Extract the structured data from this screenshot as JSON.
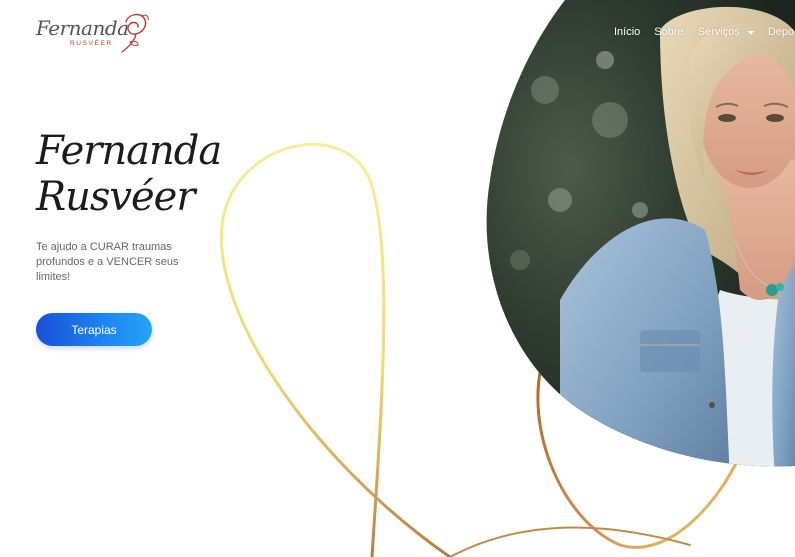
{
  "header": {
    "logo": {
      "script_text": "Fernanda",
      "sub_text": "RUSVÉER"
    },
    "nav": [
      {
        "label": "Início"
      },
      {
        "label": "Sobre"
      },
      {
        "label": "Serviços"
      },
      {
        "label": "Depo"
      }
    ]
  },
  "hero": {
    "title_line1": "Fernanda",
    "title_line2": "Rusvéer",
    "subtitle": "Te ajudo a CURAR traumas profundos e a VENCER seus limites!",
    "cta_label": "Terapias"
  },
  "colors": {
    "accent_blue": "#1d86f2",
    "ribbon_gold": "#e9cf6b",
    "ribbon_bronze": "#a86f3a",
    "logo_red": "#c0392b"
  },
  "icons": {
    "logo_mark": "rose-icon",
    "dropdown": "chevron-down-icon"
  }
}
